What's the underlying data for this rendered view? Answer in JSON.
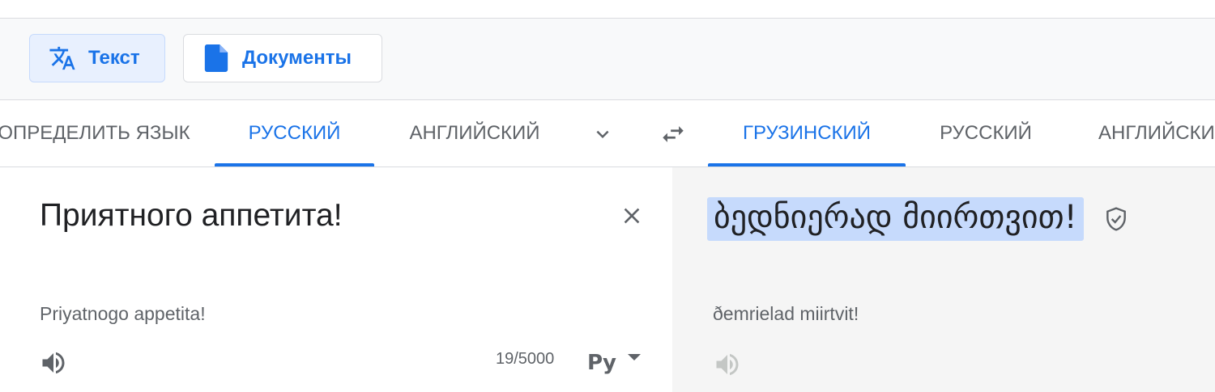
{
  "modes": {
    "text_label": "Текст",
    "docs_label": "Документы"
  },
  "source_langs": {
    "detect": "ОПРЕДЕЛИТЬ ЯЗЫК",
    "russian": "РУССКИЙ",
    "english": "АНГЛИЙСКИЙ"
  },
  "target_langs": {
    "georgian": "ГРУЗИНСКИЙ",
    "russian": "РУССКИЙ",
    "english": "АНГЛИЙСКИЙ"
  },
  "source": {
    "text": "Приятного аппетита!",
    "transliteration": "Priyatnogo appetita!",
    "char_count": "19/5000",
    "input_tool_label": "Ру"
  },
  "target": {
    "text": "ბედნიერად მიირთვით!",
    "transliteration": "ðemrielad miirtvit!"
  },
  "icons": {
    "translate": "translate-icon",
    "document": "document-icon",
    "more_languages": "chevron-down-icon",
    "swap": "swap-icon",
    "clear": "close-icon",
    "listen": "speaker-icon",
    "verified": "shield-check-icon"
  },
  "colors": {
    "accent": "#1a73e8",
    "target_background": "#f5f5f5",
    "selection_highlight": "#c6dafc"
  }
}
